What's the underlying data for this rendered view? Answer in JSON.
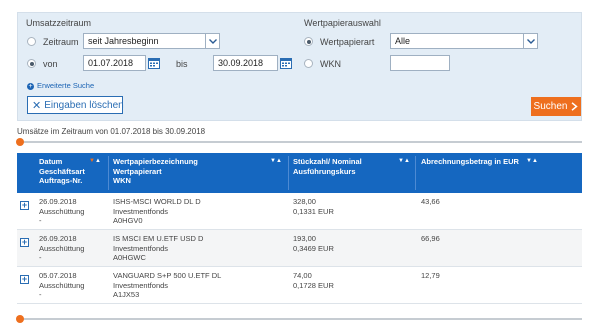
{
  "filter": {
    "umsatzzeitraum_title": "Umsatzzeitraum",
    "zeitraum_label": "Zeitraum",
    "zeitraum_value": "seit Jahresbeginn",
    "von_label": "von",
    "von_value": "01.07.2018",
    "bis_label": "bis",
    "bis_value": "30.09.2018",
    "wertpapierauswahl_title": "Wertpapierauswahl",
    "wertpapierart_label": "Wertpapierart",
    "wertpapierart_value": "Alle",
    "wkn_label": "WKN",
    "wkn_value": "",
    "erweiterte_suche": "Erweiterte Suche",
    "clear_button": "Eingaben löschen",
    "search_button": "Suchen"
  },
  "range_text": "Umsätze im Zeitraum von 01.07.2018 bis 30.09.2018",
  "table": {
    "headers": {
      "col1": [
        "Datum",
        "Geschäftsart",
        "Auftrags-Nr."
      ],
      "col2": [
        "Wertpapierbezeichnung",
        "Wertpapierart",
        "WKN"
      ],
      "col3": [
        "Stückzahl/ Nominal",
        "Ausführungskurs"
      ],
      "col4": [
        "Abrechnungsbetrag in EUR"
      ]
    },
    "rows": [
      {
        "col1": [
          "26.09.2018",
          "Ausschüttung",
          "-"
        ],
        "col2": [
          "ISHS-MSCI WORLD DL D",
          "Investmentfonds",
          "A0HGV0"
        ],
        "col3": [
          "328,00",
          "0,1331 EUR"
        ],
        "col4": "43,66"
      },
      {
        "col1": [
          "26.09.2018",
          "Ausschüttung",
          "-"
        ],
        "col2": [
          "IS MSCI EM U.ETF USD D",
          "Investmentfonds",
          "A0HGWC"
        ],
        "col3": [
          "193,00",
          "0,3469 EUR"
        ],
        "col4": "66,96"
      },
      {
        "col1": [
          "05.07.2018",
          "Ausschüttung",
          "-"
        ],
        "col2": [
          "VANGUARD S+P 500 U.ETF DL",
          "Investmentfonds",
          "A1JX53"
        ],
        "col3": [
          "74,00",
          "0,1728 EUR"
        ],
        "col4": "12,79"
      }
    ]
  },
  "colors": {
    "accent_orange": "#ee6f1e",
    "header_blue": "#1567c0",
    "panel_bg": "#e3edf6"
  }
}
